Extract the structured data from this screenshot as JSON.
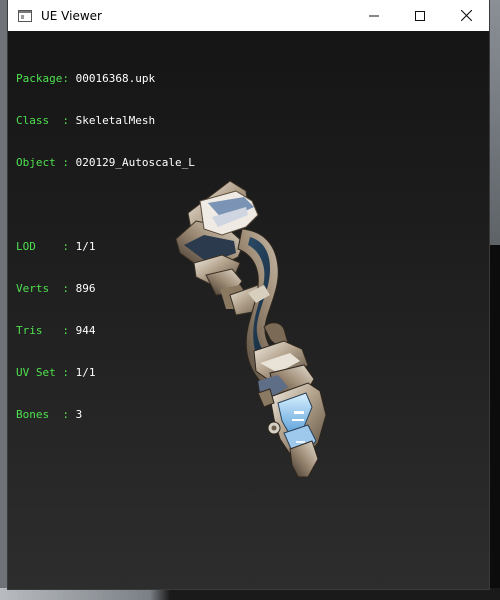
{
  "window": {
    "title": "UE Viewer"
  },
  "info": {
    "package": {
      "label": "Package",
      "value": "00016368.upk"
    },
    "class": {
      "label": "Class  ",
      "value": "SkeletalMesh"
    },
    "object": {
      "label": "Object ",
      "value": "020129_Autoscale_L"
    },
    "lod": {
      "label": "LOD    ",
      "value": "1/1"
    },
    "verts": {
      "label": "Verts  ",
      "value": "896"
    },
    "tris": {
      "label": "Tris   ",
      "value": "944"
    },
    "uvset": {
      "label": "UV Set ",
      "value": "1/1"
    },
    "bones": {
      "label": "Bones  ",
      "value": "3"
    }
  },
  "colors": {
    "label_green": "#4fe04f",
    "value_white": "#ffffff",
    "viewport_bg": "#1c1c1c"
  }
}
